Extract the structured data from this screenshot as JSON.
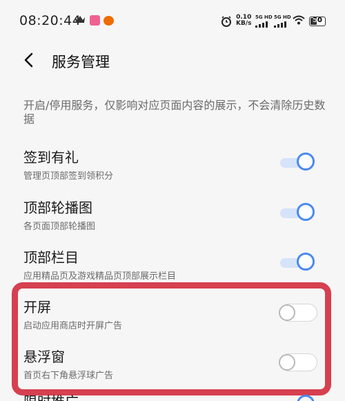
{
  "status_bar": {
    "time": "08:20:44",
    "icons": [
      "crown-icon",
      "app-badge-icon",
      "pumpkin-icon",
      "alarm-icon",
      "wifi-icon",
      "battery-icon"
    ],
    "net_speed_value": "0.10",
    "net_speed_unit": "KB/s",
    "sim1_label": "5G HD",
    "sim2_label": "5G HD",
    "battery_level": "50"
  },
  "header": {
    "back_icon": "chevron-left-icon",
    "title": "服务管理"
  },
  "description": "开启/停用服务，仅影响对应页面内容的展示，不会清除历史数据",
  "settings": [
    {
      "title": "签到有礼",
      "subtitle": "管理页顶部签到领积分",
      "enabled": true
    },
    {
      "title": "顶部轮播图",
      "subtitle": "各页面顶部轮播图",
      "enabled": true
    },
    {
      "title": "顶部栏目",
      "subtitle": "应用精品页及游戏精品页顶部展示栏目",
      "enabled": true
    },
    {
      "title": "开屏",
      "subtitle": "启动应用商店时开屏广告",
      "enabled": false
    },
    {
      "title": "悬浮窗",
      "subtitle": "首页右下角悬浮球广告",
      "enabled": false
    }
  ],
  "partial_item": {
    "title": "限时推广",
    "enabled": true
  },
  "colors": {
    "accent": "#4a89f0",
    "highlight_border": "#d64050",
    "background": "#f6f6f6"
  }
}
